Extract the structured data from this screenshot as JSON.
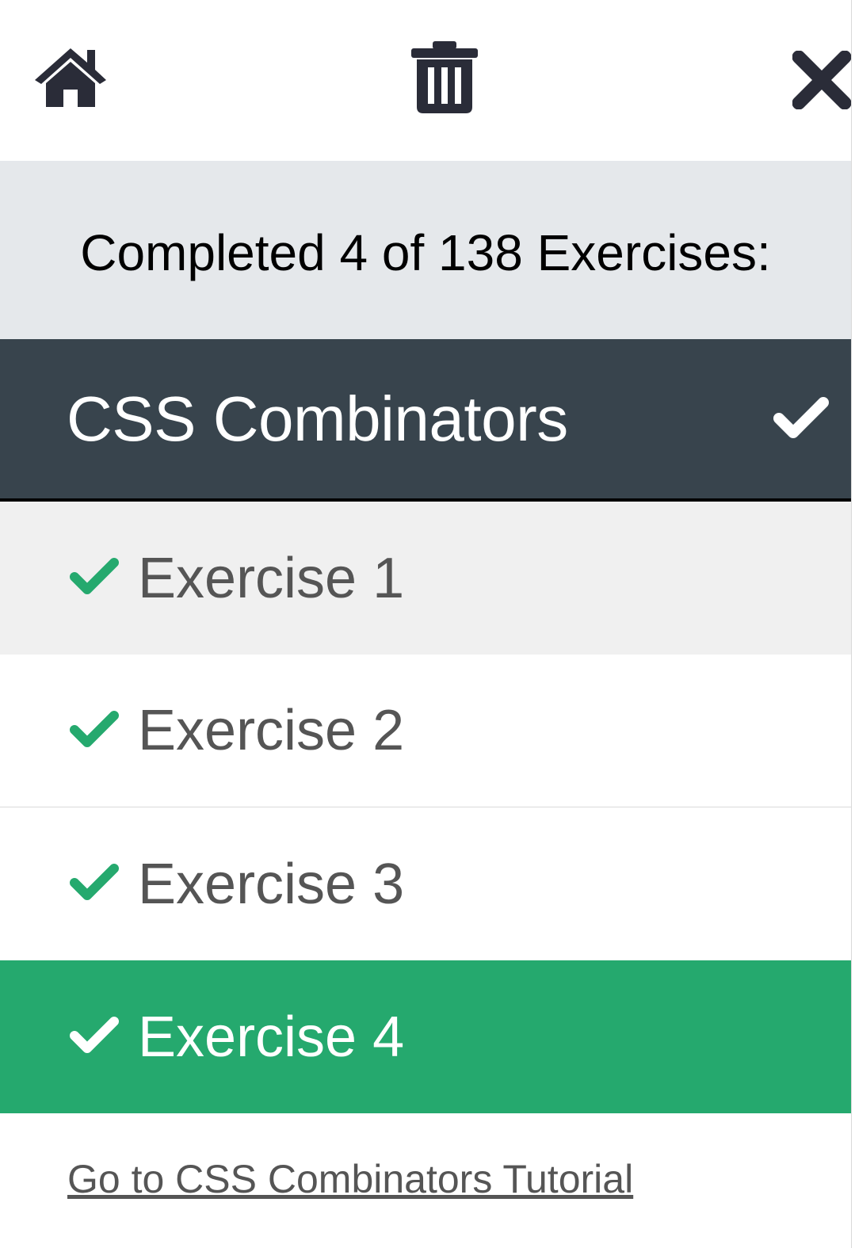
{
  "toolbar": {
    "home_icon": "home-icon",
    "trash_icon": "trash-icon",
    "close_icon": "close-icon"
  },
  "progress": {
    "text": "Completed 4 of 138 Exercises:",
    "completed": 4,
    "total": 138
  },
  "section": {
    "title": "CSS Combinators",
    "check_icon": "check-icon"
  },
  "exercises": [
    {
      "label": "Exercise 1",
      "state": "completed"
    },
    {
      "label": "Exercise 2",
      "state": "completed"
    },
    {
      "label": "Exercise 3",
      "state": "completed"
    },
    {
      "label": "Exercise 4",
      "state": "completed-current"
    }
  ],
  "footer": {
    "link": "Go to CSS Combinators Tutorial"
  },
  "colors": {
    "accent_green": "#25a96e",
    "header_dark": "#38444d",
    "progress_bg": "#e5e8eb",
    "hover_bg": "#f0f0f0",
    "icon_dark": "#2a2c38"
  }
}
